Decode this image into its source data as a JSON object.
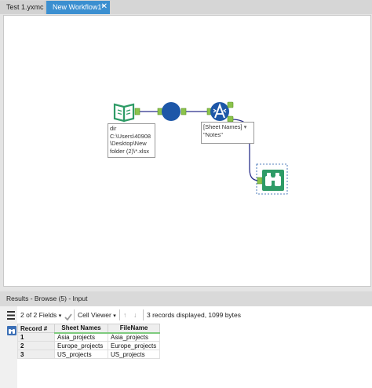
{
  "tabs": [
    {
      "label": "Test 1.yxmc",
      "active": false
    },
    {
      "label": "New Workflow1*",
      "active": true
    }
  ],
  "tab_close_glyph": "✕",
  "canvas": {
    "dir_annotation": [
      "dir",
      "C:\\Users\\40908",
      "\\Desktop\\New",
      "folder (2)\\*.xlsx"
    ],
    "text_annotation": [
      "[Sheet Names]",
      "\"Notes\""
    ],
    "tools": [
      {
        "name": "input-book-icon",
        "color": "#2e9b66"
      },
      {
        "name": "circle-tool-icon",
        "color": "#1d57a8"
      },
      {
        "name": "formula-a-icon",
        "color": "#1d57a8"
      },
      {
        "name": "browse-binoculars-icon",
        "color": "#2e9b66"
      }
    ],
    "connector_color": "#2a2f8a",
    "anchor_color": "#8bc34a"
  },
  "results": {
    "header": "Results - Browse (5) - Input",
    "fields_label": "2 of 2 Fields",
    "cell_viewer_label": "Cell Viewer",
    "status": "3 records displayed, 1099 bytes",
    "columns": [
      "Record #",
      "Sheet Names",
      "FileName"
    ],
    "rows": [
      [
        "1",
        "Asia_projects",
        "Asia_projects"
      ],
      [
        "2",
        "Europe_projects",
        "Europe_projects"
      ],
      [
        "3",
        "US_projects",
        "US_projects"
      ]
    ]
  }
}
